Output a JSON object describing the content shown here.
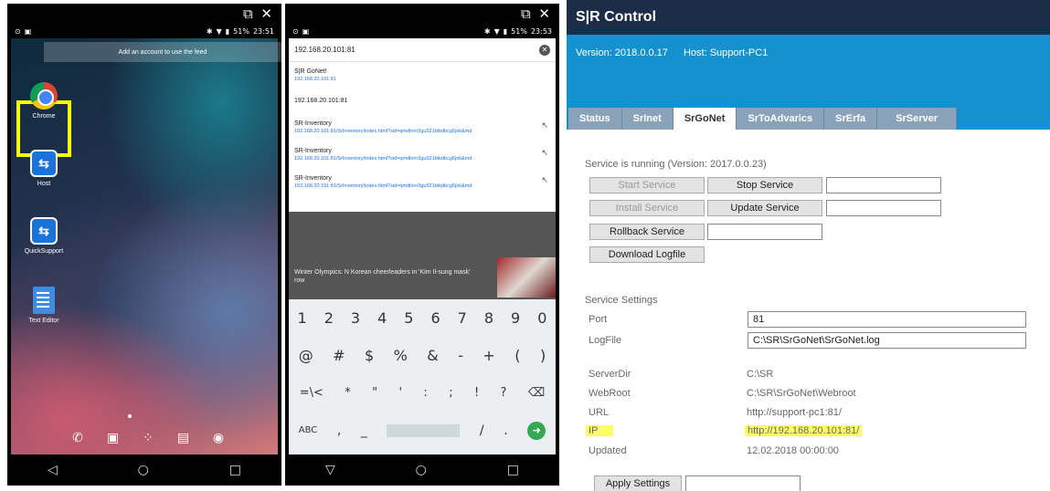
{
  "window_controls": "⧉ ✕",
  "phone1": {
    "status_time": "23:51",
    "battery": "51%",
    "feed_banner": "Add an account to use the feed",
    "apps": [
      {
        "label": "Chrome"
      },
      {
        "label": "Host"
      },
      {
        "label": "QuickSupport"
      },
      {
        "label": "Text Editor"
      }
    ]
  },
  "phone2": {
    "status_time": "23:53",
    "battery": "51%",
    "url_value": "192.168.20.101:81",
    "suggestions": [
      {
        "title": "S|R GoNet!",
        "url": "192.168.20.101:81"
      },
      {
        "title": "192.168.20.101:81",
        "url": ""
      },
      {
        "title": "SR-Inventory",
        "url": "192.168.20.101:81/SrInventory/index.html?sid=qmdlnnr3gu521btkdbcg5jok&md"
      },
      {
        "title": "SR-Inventory",
        "url": "192.168.20.101:81/SrInventory/index.html?sid=qmdlnnr3gu521btkdbcg5jok&md"
      },
      {
        "title": "SR-Inventory",
        "url": "192.168.20.101:81/SrInventory/index.html?sid=qmdlnnr3gu521btkdbcg5jok&md"
      }
    ],
    "news_headline": "Winter Olympics: N Korean cheerleaders in 'Kim Il-sung mask' row",
    "keys_row1": [
      "1",
      "2",
      "3",
      "4",
      "5",
      "6",
      "7",
      "8",
      "9",
      "0"
    ],
    "keys_row2": [
      "@",
      "#",
      "$",
      "%",
      "&",
      "-",
      "+",
      "(",
      ")"
    ],
    "keys_row3": [
      "=\\<",
      "*",
      "\"",
      "'",
      ":",
      ";",
      "!",
      "?",
      "⌫"
    ],
    "keys_row4_left": "ABC",
    "keys_row4_comma": ",",
    "keys_row4_under": "_",
    "keys_row4_slash": "/",
    "keys_row4_dot": "."
  },
  "sr": {
    "title": "S|R Control",
    "version": "Version: 2018.0.0.17",
    "host": "Host: Support-PC1",
    "tabs": [
      "Status",
      "SrInet",
      "SrGoNet",
      "SrToAdvarics",
      "SrErfa",
      "SrServer"
    ],
    "active_tab": "SrGoNet",
    "service_status": "Service is running (Version: 2017.0.0.23)",
    "buttons": {
      "start": "Start Service",
      "stop": "Stop Service",
      "install": "Install Service",
      "update": "Update Service",
      "rollback": "Rollback Service",
      "download": "Download Logfile",
      "apply": "Apply Settings"
    },
    "settings_heading": "Service Settings",
    "port_label": "Port",
    "port_value": "81",
    "logfile_label": "LogFile",
    "logfile_value": "C:\\SR\\SrGoNet\\SrGoNet.log",
    "serverdir_label": "ServerDir",
    "serverdir_value": "C:\\SR",
    "webroot_label": "WebRoot",
    "webroot_value": "C:\\SR\\SrGoNet\\Webroot",
    "url_label": "URL",
    "url_value": "http://support-pc1:81/",
    "ip_label": "IP",
    "ip_value": "http://192.168.20.101:81/",
    "updated_label": "Updated",
    "updated_value": "12.02.2018 00:00:00"
  }
}
